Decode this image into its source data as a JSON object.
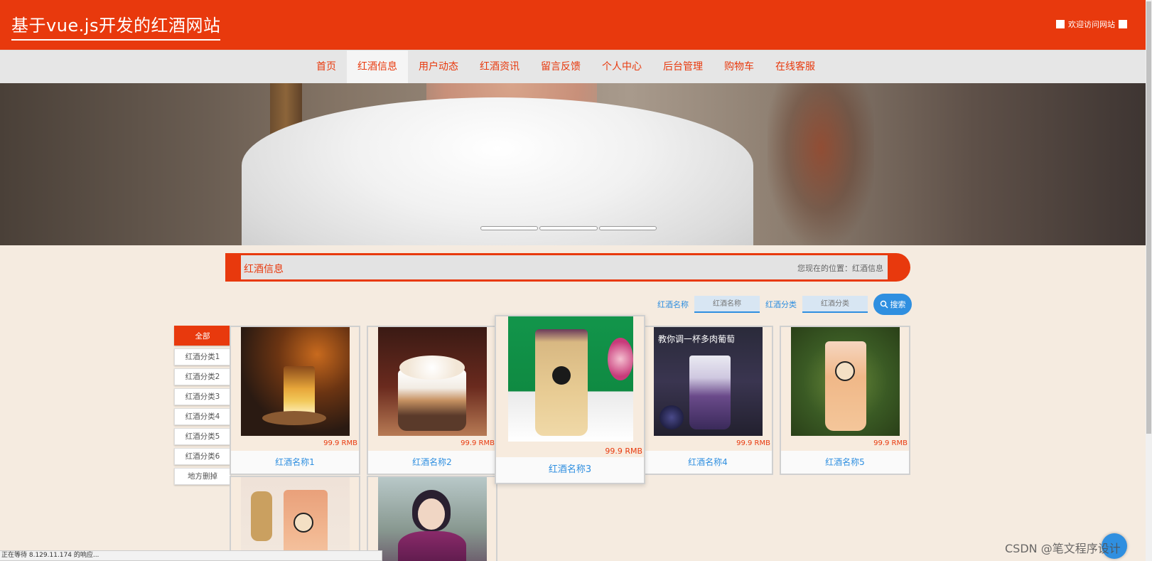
{
  "header": {
    "site_title": "基于vue.js开发的红酒网站",
    "welcome": "欢迎访问网站"
  },
  "nav": {
    "items": [
      "首页",
      "红酒信息",
      "用户动态",
      "红酒资讯",
      "留言反馈",
      "个人中心",
      "后台管理",
      "购物车",
      "在线客服"
    ],
    "active": "红酒信息"
  },
  "section": {
    "title": "红酒信息",
    "location": "您现在的位置：红酒信息"
  },
  "search": {
    "name_label": "红酒名称",
    "name_placeholder": "红酒名称",
    "category_label": "红酒分类",
    "category_placeholder": "红酒分类",
    "button": "搜索"
  },
  "categories": [
    "全部",
    "红酒分类1",
    "红酒分类2",
    "红酒分类3",
    "红酒分类4",
    "红酒分类5",
    "红酒分类6",
    "地方删掉"
  ],
  "products": [
    {
      "name": "红酒名称1",
      "price": "99.9 RMB"
    },
    {
      "name": "红酒名称2",
      "price": "99.9 RMB"
    },
    {
      "name": "红酒名称3",
      "price": "99.9 RMB"
    },
    {
      "name": "红酒名称4",
      "price": "99.9 RMB"
    },
    {
      "name": "红酒名称5",
      "price": "99.9 RMB"
    }
  ],
  "status_bar": "正在等待 8.129.11.174 的响应...",
  "watermark": "CSDN @笔文程序设计",
  "colors": {
    "brand": "#e8390d",
    "accent": "#2f8fe0",
    "background": "#f5ebe0"
  }
}
